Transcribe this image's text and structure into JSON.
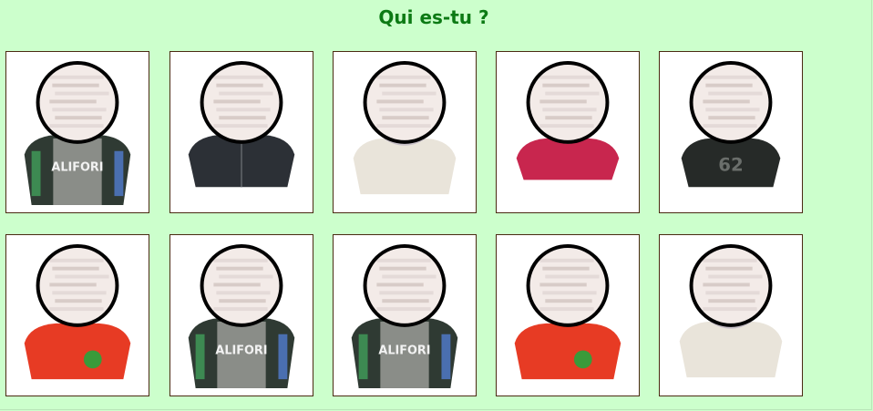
{
  "header": {
    "title": "Qui es-tu ?"
  },
  "colors": {
    "background": "#ccffcc",
    "title": "#0c7a14",
    "card_border": "#4a2a12"
  },
  "cards": [
    {
      "shirt": "jacket-green",
      "print": "ALIFORI"
    },
    {
      "shirt": "dark-hoodie",
      "print": ""
    },
    {
      "shirt": "cream-sweater",
      "print": ""
    },
    {
      "shirt": "pink-shirt",
      "print": ""
    },
    {
      "shirt": "black-62",
      "print": "62"
    },
    {
      "shirt": "red-pjmasks",
      "print": ""
    },
    {
      "shirt": "jacket-green",
      "print": "ALIFORI"
    },
    {
      "shirt": "jacket-green",
      "print": "ALIFORI"
    },
    {
      "shirt": "red-pjmasks",
      "print": ""
    },
    {
      "shirt": "cream-sweater",
      "print": ""
    }
  ]
}
